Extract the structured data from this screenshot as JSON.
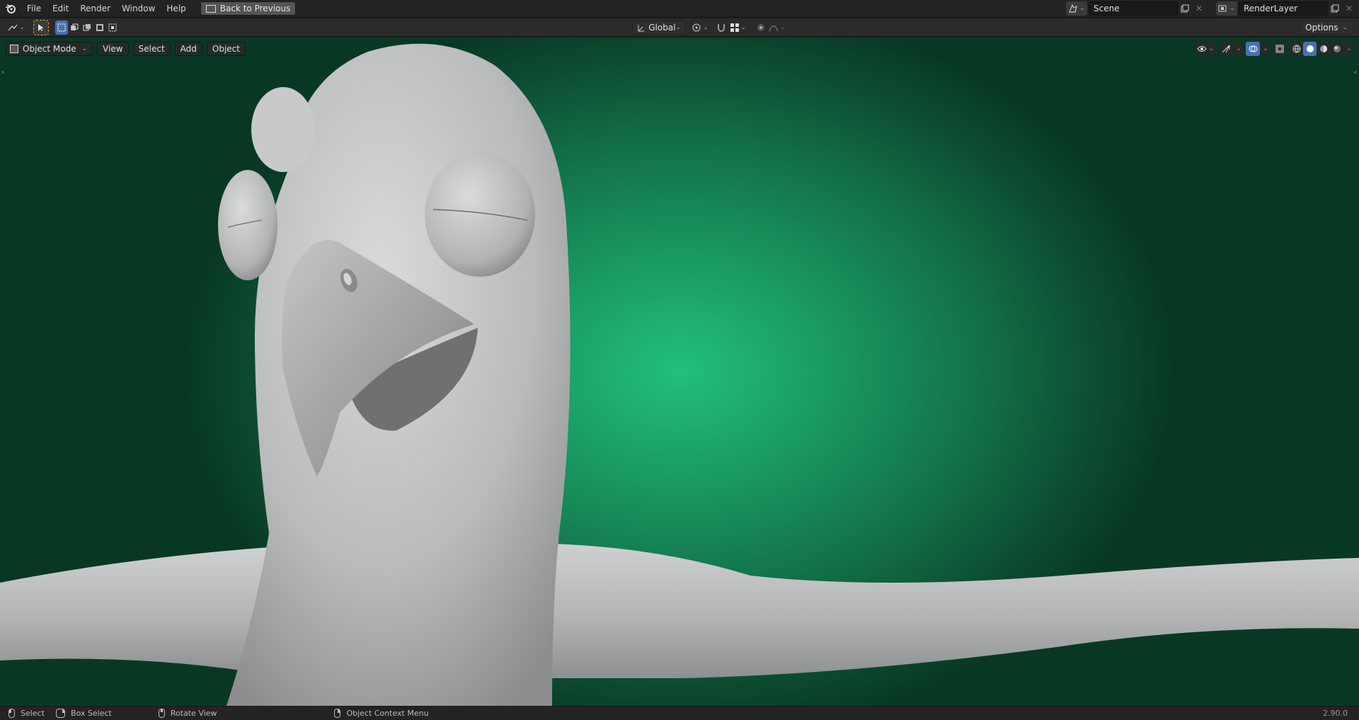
{
  "topbar": {
    "menus": [
      "File",
      "Edit",
      "Render",
      "Window",
      "Help"
    ],
    "back_label": "Back to Previous",
    "scene_name": "Scene",
    "render_layer": "RenderLayer"
  },
  "toolbar": {
    "orientation": "Global",
    "options_label": "Options"
  },
  "viewport": {
    "mode_label": "Object Mode",
    "menus": [
      "View",
      "Select",
      "Add",
      "Object"
    ]
  },
  "statusbar": {
    "select": "Select",
    "box_select": "Box Select",
    "rotate_view": "Rotate View",
    "context_menu": "Object Context Menu",
    "version": "2.90.0"
  },
  "colors": {
    "accent": "#4772b3",
    "bg_center": "#22bf7c",
    "bg_edge": "#083824"
  }
}
